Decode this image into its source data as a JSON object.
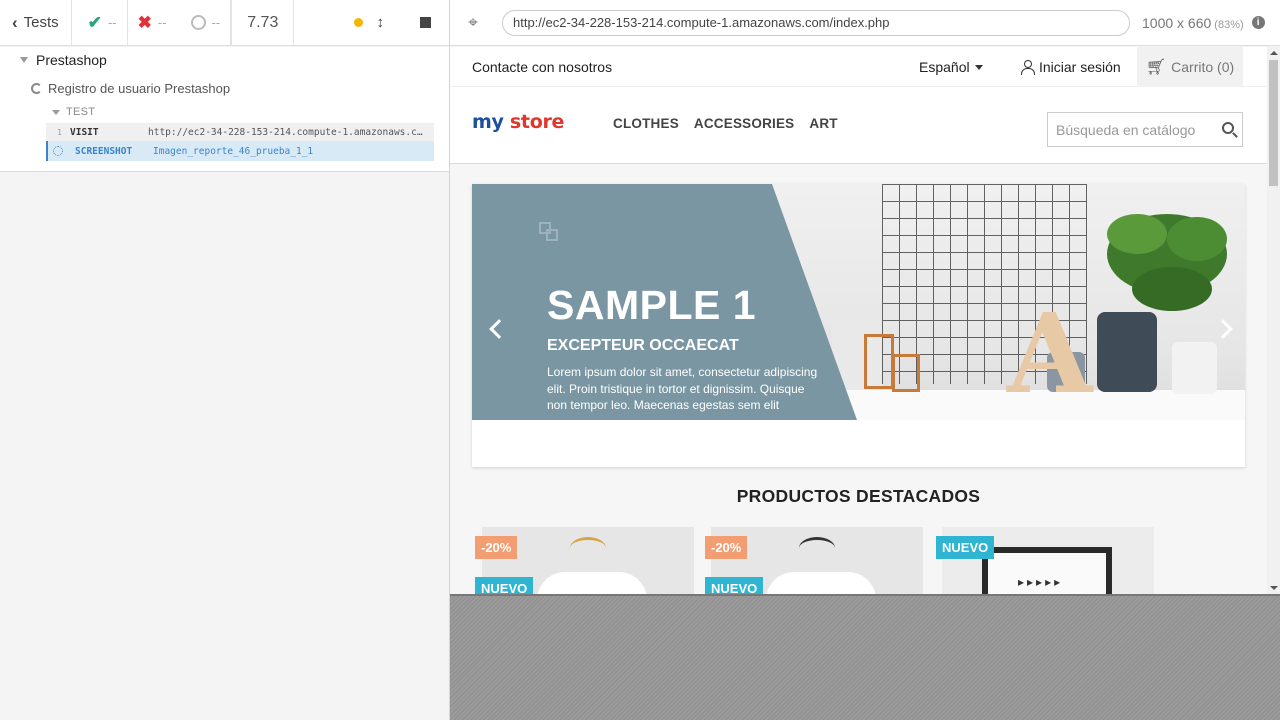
{
  "runner": {
    "tests_label": "Tests",
    "passed": "--",
    "failed": "--",
    "pending": "--",
    "duration": "7.73"
  },
  "tree": {
    "suite": "Prestashop",
    "test": "Registro de usuario Prestashop",
    "hook": "TEST",
    "commands": [
      {
        "num": "1",
        "name": "VISIT",
        "message": "http://ec2-34-228-153-214.compute-1.amazonaws.c..."
      },
      {
        "num": "",
        "name": "SCREENSHOT",
        "message": "Imagen_reporte_46_prueba_1_1"
      }
    ]
  },
  "browser": {
    "url": "http://ec2-34-228-153-214.compute-1.amazonaws.com/index.php",
    "viewport": "1000 x 660",
    "scale": "(83%)"
  },
  "store": {
    "contact": "Contacte con nosotros",
    "language": "Español",
    "signin": "Iniciar sesión",
    "cart": "Carrito (0)",
    "logo_my": "my",
    "logo_store": "store",
    "menu": [
      "CLOTHES",
      "ACCESSORIES",
      "ART"
    ],
    "search_placeholder": "Búsqueda en catálogo",
    "slide": {
      "title": "SAMPLE 1",
      "subtitle": "EXCEPTEUR OCCAECAT",
      "text": "Lorem ipsum dolor sit amet, consectetur adipiscing elit. Proin tristique in tortor et dignissim. Quisque non tempor leo. Maecenas egestas sem elit"
    },
    "featured_title": "PRODUCTOS DESTACADOS",
    "products": [
      {
        "discount": "-20%",
        "new": "NUEVO"
      },
      {
        "discount": "-20%",
        "new": "NUEVO"
      },
      {
        "new": "NUEVO"
      }
    ]
  },
  "colors": {
    "pass": "#2aa57a",
    "fail": "#e0323b",
    "running": "#f5b500",
    "banner": "#7a96a3",
    "discount_flag": "#f39d72",
    "new_flag": "#2fb5d2",
    "logo_blue": "#1d4f9c",
    "logo_red": "#e0362c"
  }
}
